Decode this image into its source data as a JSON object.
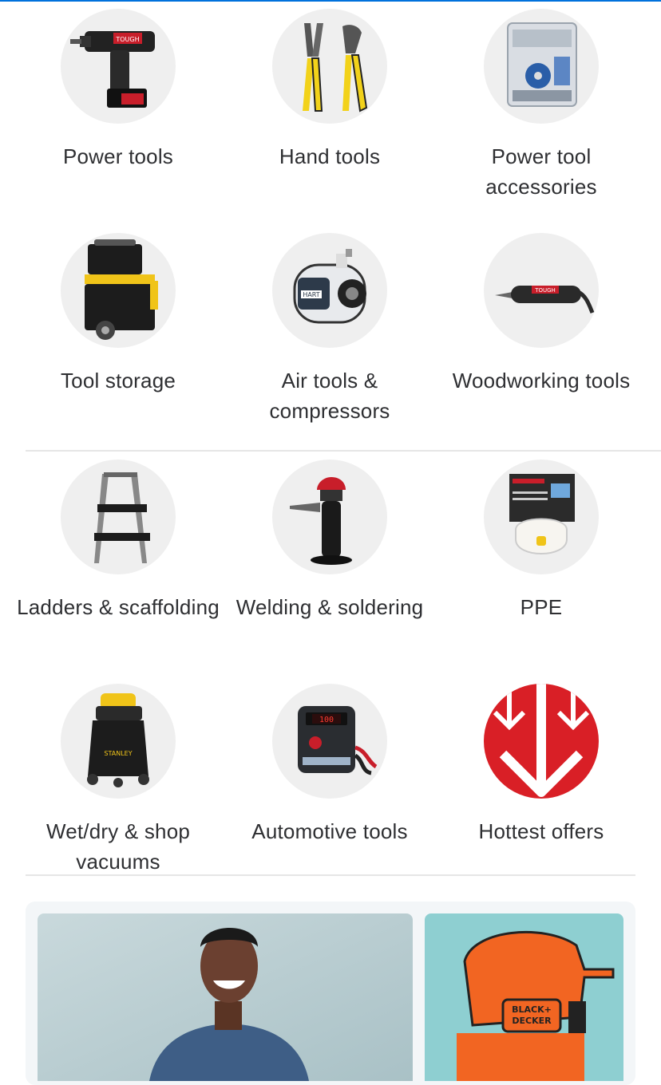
{
  "categories": [
    {
      "label": "Power tools"
    },
    {
      "label": "Hand tools"
    },
    {
      "label": "Power tool accessories"
    },
    {
      "label": "Tool storage"
    },
    {
      "label": "Air tools & compressors"
    },
    {
      "label": "Woodworking tools"
    },
    {
      "label": "Ladders & scaffolding"
    },
    {
      "label": "Welding & soldering"
    },
    {
      "label": "PPE"
    },
    {
      "label": "Wet/dry & shop vacuums"
    },
    {
      "label": "Automotive tools"
    },
    {
      "label": "Hottest offers"
    }
  ],
  "product_marks": {
    "drill_brand": "TOUGH",
    "compressor_brand": "HART",
    "rotary_brand": "TOUGH",
    "vacuum_brand": "STANLEY",
    "charger_display": "100",
    "jigsaw_brand_line1": "BLACK+",
    "jigsaw_brand_line2": "DECKER"
  },
  "colors": {
    "accent": "#0071dc",
    "offers_red": "#d91f26",
    "circle_bg": "#efefef",
    "text": "#2e2f32"
  }
}
